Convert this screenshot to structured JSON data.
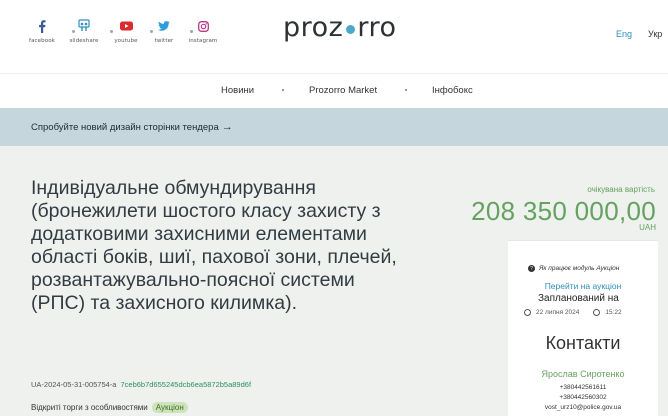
{
  "header": {
    "logo_left": "proz",
    "logo_right": "rro",
    "social": [
      {
        "label": "facebook",
        "icon": "facebook-icon"
      },
      {
        "label": "slideshare",
        "icon": "slideshare-icon"
      },
      {
        "label": "youtube",
        "icon": "youtube-icon"
      },
      {
        "label": "twitter",
        "icon": "twitter-icon"
      },
      {
        "label": "instagram",
        "icon": "instagram-icon"
      }
    ],
    "lang_en": "Eng",
    "lang_uk": "Укр"
  },
  "nav": {
    "items": [
      "Новини",
      "Prozorro Market",
      "Інфобокс"
    ]
  },
  "banner": {
    "text": "Спробуйте новий дизайн сторінки тендера",
    "arrow": "→"
  },
  "tender": {
    "title": "Індивідуальне обмундирування (бронежилети шостого класу захисту з додатковими захисними елементами області боків, шиї, пахової зони, плечей, розвантажувально-поясної системи (РПС) та захисного килимка).",
    "id": "UA-2024-05-31-005754-a",
    "hash": "7ceb6b7d655245dcb6ea5872b5a89d6f",
    "procedure": "Відкриті торги з особливостями",
    "badge": "Аукціон",
    "expected_label": "очікувана вартість",
    "amount": "208 350 000,00",
    "currency": "UAH"
  },
  "card": {
    "how_auction": "Як працює модуль Аукціон",
    "go_auction": "Перейти на аукціон",
    "status": "Запланований на",
    "date": "22 липня 2024",
    "time": "15:22",
    "contacts_title": "Контакти",
    "person": "Ярослав Сиротенко",
    "phone1": "+380442561611",
    "phone2": "+380442560302",
    "email": "vost_urz10@police.gov.ua"
  },
  "colors": {
    "accent_green": "#65a15f",
    "link_blue": "#2e8fb8",
    "banner_bg": "#c5d6dc",
    "page_bg": "#eef1ee"
  }
}
